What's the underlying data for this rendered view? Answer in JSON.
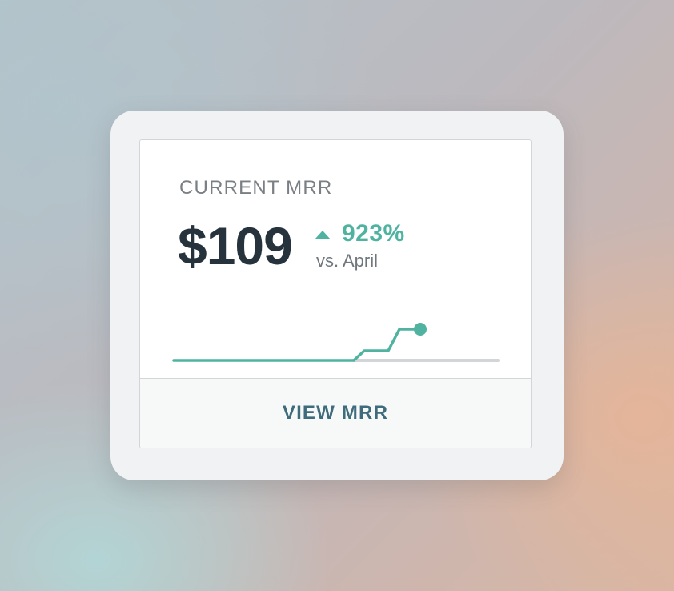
{
  "widget": {
    "label": "CURRENT MRR",
    "value": "$109",
    "change": {
      "direction": "up",
      "value": "923%",
      "comparison": "vs. April",
      "color": "#4fb3a0"
    },
    "action_label": "VIEW MRR"
  },
  "colors": {
    "accent": "#4fb3a0",
    "value_text": "#26323c",
    "action_text": "#3f6c7c",
    "baseline": "#d3d6d9"
  }
}
